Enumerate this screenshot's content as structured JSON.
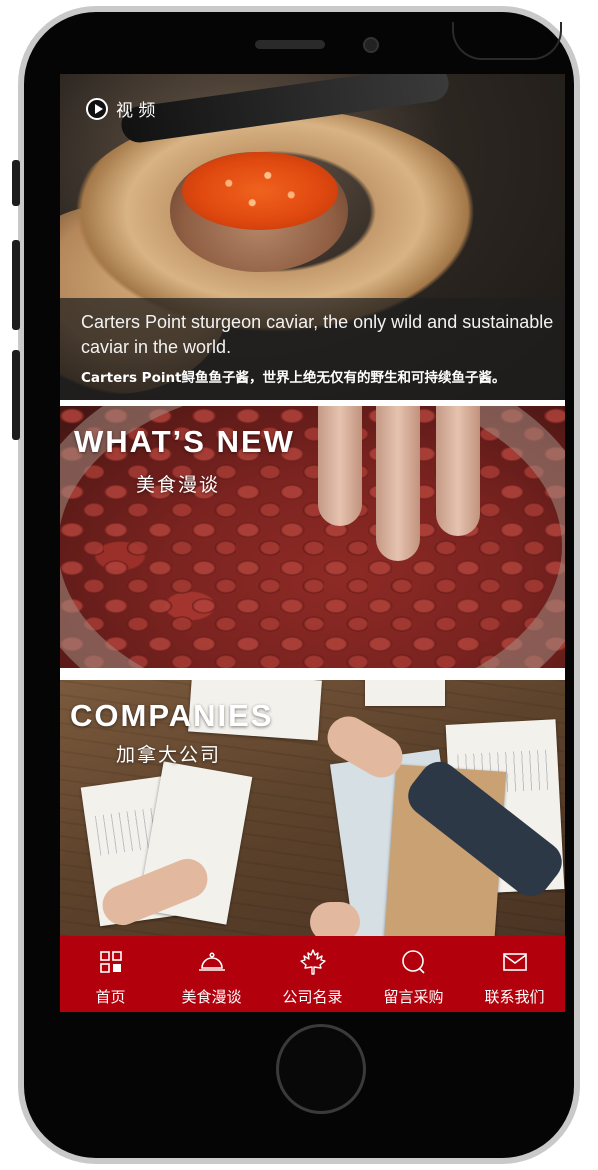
{
  "video": {
    "label": "视 频"
  },
  "banner": {
    "caption_en": "Carters Point sturgeon caviar, the only wild and sustainable caviar in the world.",
    "caption_zh": "Carters Point鲟鱼鱼子酱，世界上绝无仅有的野生和可持续鱼子酱。"
  },
  "sections": [
    {
      "title": "WHAT’S NEW",
      "subtitle": "美食漫谈"
    },
    {
      "title": "COMPANIES",
      "subtitle": "加拿大公司"
    }
  ],
  "nav": {
    "items": [
      {
        "label": "首页",
        "icon": "grid-icon"
      },
      {
        "label": "美食漫谈",
        "icon": "cloche-icon"
      },
      {
        "label": "公司名录",
        "icon": "maple-leaf-icon"
      },
      {
        "label": "留言采购",
        "icon": "chat-icon"
      },
      {
        "label": "联系我们",
        "icon": "mail-icon"
      }
    ]
  },
  "colors": {
    "nav_bg": "#b3000d",
    "caption_bg": "#1e1e1e"
  }
}
